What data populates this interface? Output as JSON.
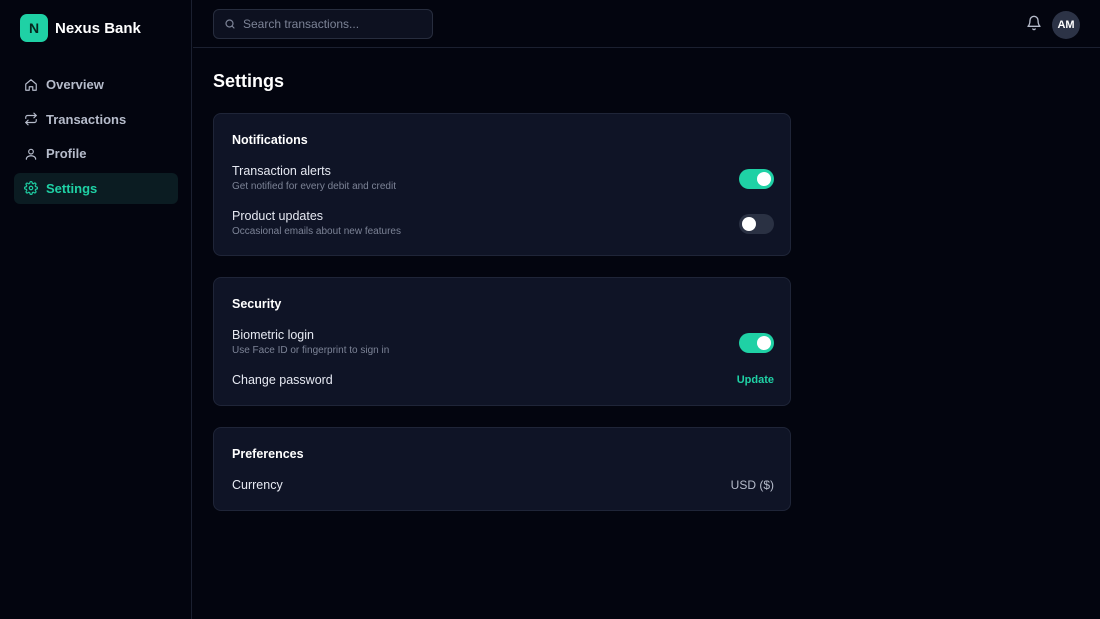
{
  "brand": {
    "logo_letter": "N",
    "name": "Nexus Bank",
    "accent": "#1fd1a5"
  },
  "sidebar": {
    "items": [
      {
        "label": "Overview",
        "icon": "home-icon",
        "active": false
      },
      {
        "label": "Transactions",
        "icon": "swap-arrows-icon",
        "active": false
      },
      {
        "label": "Profile",
        "icon": "user-icon",
        "active": false
      },
      {
        "label": "Settings",
        "icon": "gear-icon",
        "active": true
      }
    ]
  },
  "topbar": {
    "search": {
      "placeholder": "Search transactions...",
      "value": ""
    },
    "bell_icon": "bell-icon",
    "avatar_initials": "AM"
  },
  "page": {
    "title": "Settings"
  },
  "sections": {
    "notifications": {
      "title": "Notifications",
      "transaction_alerts": {
        "label": "Transaction alerts",
        "desc": "Get notified for every debit and credit",
        "enabled": true
      },
      "product_updates": {
        "label": "Product updates",
        "desc": "Occasional emails about new features",
        "enabled": false
      }
    },
    "security": {
      "title": "Security",
      "biometric_login": {
        "label": "Biometric login",
        "desc": "Use Face ID or fingerprint to sign in",
        "enabled": true
      },
      "change_password": {
        "label": "Change password",
        "action": "Update"
      }
    },
    "preferences": {
      "title": "Preferences",
      "currency": {
        "label": "Currency",
        "value": "USD ($)"
      }
    }
  },
  "colors": {
    "background": "#03050f",
    "card": "#0f1426",
    "toggle_on": "#1fd1a5",
    "toggle_off": "#2a3143"
  }
}
